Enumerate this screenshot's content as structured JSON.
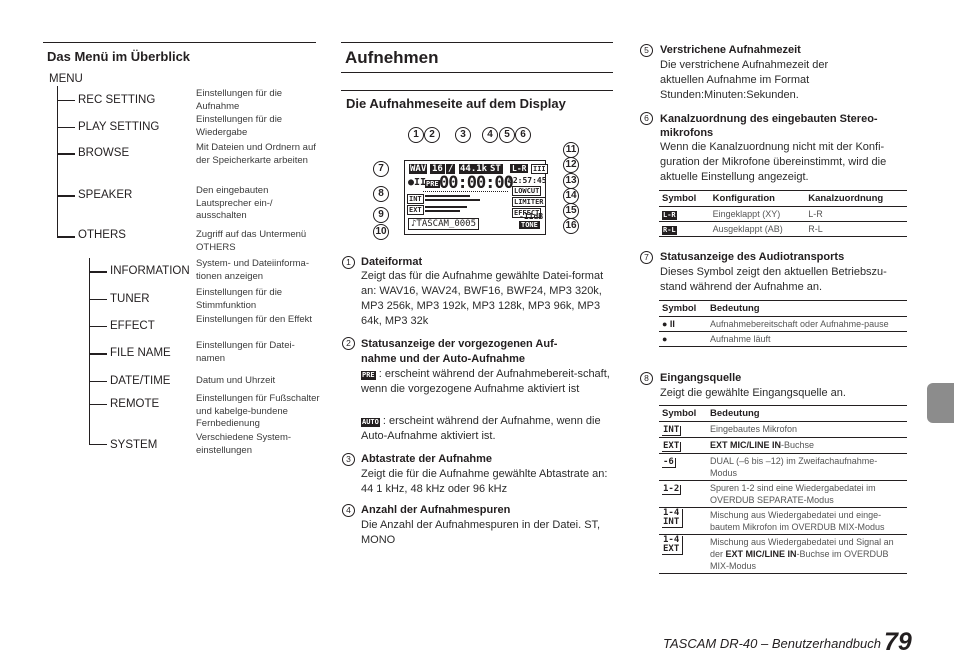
{
  "menu_section": {
    "heading": "Das Menü im Überblick",
    "root": "MENU",
    "items": [
      {
        "label": "REC SETTING",
        "desc": "Einstellungen für die Aufnahme"
      },
      {
        "label": "PLAY SETTING",
        "desc": "Einstellungen für die Wiedergabe"
      },
      {
        "label": "BROWSE",
        "desc": "Mit Dateien und Ordnern auf der Speicherkarte arbeiten"
      },
      {
        "label": "SPEAKER",
        "desc": "Den eingebauten Lautsprecher ein-/ ausschalten"
      },
      {
        "label": "OTHERS",
        "desc": "Zugriff auf das Untermenü OTHERS"
      }
    ],
    "sub_items": [
      {
        "label": "INFORMATION",
        "desc": "System- und Dateiinforma-tionen anzeigen"
      },
      {
        "label": "TUNER",
        "desc": "Einstellungen für die Stimmfunktion"
      },
      {
        "label": "EFFECT",
        "desc": "Einstellungen für den Effekt"
      },
      {
        "label": "FILE NAME",
        "desc": "Einstellungen für Datei-namen"
      },
      {
        "label": "DATE/TIME",
        "desc": "Datum und Uhrzeit"
      },
      {
        "label": "REMOTE",
        "desc": "Einstellungen für Fußschalter und kabelge-bundene Fernbedienung"
      },
      {
        "label": "SYSTEM",
        "desc": "Verschiedene System-einstellungen"
      }
    ]
  },
  "record_section": {
    "title": "Aufnehmen",
    "subtitle": "Die Aufnahmeseite auf dem Display",
    "display": {
      "format": "WAV",
      "bits": "16",
      "slash": "/",
      "rate": "44.1k",
      "channels": "ST",
      "mic": "L-R",
      "battery": "III",
      "transport": "●II",
      "pre": "PRE",
      "elapsed": "00:00:00",
      "remaining": "02:57:45",
      "lowcut": "LOWCUT",
      "limiter": "LIMITER",
      "effect": "EFFECT",
      "level": "-11dB",
      "tone": "TONE",
      "int": "INT",
      "ext": "EXT",
      "filename": "♪TASCAM_0005",
      "callouts": [
        "1",
        "2",
        "3",
        "4",
        "5",
        "6",
        "7",
        "8",
        "9",
        "10",
        "11",
        "12",
        "13",
        "14",
        "15",
        "16"
      ]
    },
    "items": [
      {
        "num": "1",
        "title": "Dateiformat",
        "body": "Zeigt das für die Aufnahme gewählte Datei-format an: WAV16, WAV24, BWF16, BWF24, MP3 320k, MP3 256k, MP3 192k, MP3 128k, MP3 96k, MP3 64k, MP3 32k"
      },
      {
        "num": "2",
        "title": "Statusanzeige der vorgezogenen Auf-nahme und der Auto-Aufnahme",
        "pre_symbol": "PRE",
        "pre_text": " : erscheint während der Aufnahmebereit-schaft, wenn die vorgezogene Aufnahme aktiviert ist",
        "auto_symbol": "AUTO",
        "auto_text": " : erscheint während der Aufnahme, wenn die Auto-Aufnahme aktiviert ist."
      },
      {
        "num": "3",
        "title": "Abtastrate der Aufnahme",
        "body": "Zeigt die für die Aufnahme gewählte Abtastrate an: 44 1 kHz, 48 kHz oder 96 kHz"
      },
      {
        "num": "4",
        "title": "Anzahl der Aufnahmespuren",
        "body": "Die Anzahl der Aufnahmespuren in der Datei. ST, MONO"
      }
    ]
  },
  "right_column": {
    "items": [
      {
        "num": "5",
        "title": "Verstrichene Aufnahmezeit",
        "body": "Die verstrichene Aufnahmezeit der aktuellen Aufnahme im Format Stunden:Minuten:Sekunden."
      },
      {
        "num": "6",
        "title": "Kanalzuordnung des eingebauten Stereo-mikrofons",
        "body": "Wenn die Kanalzuordnung nicht mit der Konfi-guration der Mikrofone übereinstimmt, wird die aktuelle Einstellung angezeigt."
      },
      {
        "num": "7",
        "title": "Statusanzeige des Audiotransports",
        "body": "Dieses Symbol zeigt den aktuellen Betriebszu-stand während der Aufnahme an."
      },
      {
        "num": "8",
        "title": "Eingangsquelle",
        "body": "Zeigt die gewählte Eingangsquelle an."
      }
    ],
    "table_mic": {
      "headers": [
        "Symbol",
        "Konfiguration",
        "Kanalzuordnung"
      ],
      "rows": [
        {
          "symbol": "L-R",
          "config": "Eingeklappt (XY)",
          "mapping": "L-R"
        },
        {
          "symbol": "R-L",
          "config": "Ausgeklappt (AB)",
          "mapping": "R-L"
        }
      ]
    },
    "table_transport": {
      "headers": [
        "Symbol",
        "Bedeutung"
      ],
      "rows": [
        {
          "symbol": "● II",
          "meaning": "Aufnahmebereitschaft oder Aufnahme-pause"
        },
        {
          "symbol": "●",
          "meaning": "Aufnahme läuft"
        }
      ]
    },
    "table_input": {
      "headers": [
        "Symbol",
        "Bedeutung"
      ],
      "rows": [
        {
          "symbol": "INT",
          "meaning": "Eingebautes Mikrofon"
        },
        {
          "symbol": "EXT",
          "meaning_bold": "EXT MIC/LINE IN",
          "meaning": "-Buchse"
        },
        {
          "symbol": "-6",
          "meaning": "DUAL (–6 bis –12) im Zweifachaufnahme-Modus"
        },
        {
          "symbol": "1-2",
          "meaning": "Spuren 1-2 sind eine Wiedergabedatei im OVERDUB SEPARATE-Modus"
        },
        {
          "symbol": "1-4 INT",
          "meaning": "Mischung aus Wiedergabedatei und einge-bautem Mikrofon im OVERDUB MIX-Modus"
        },
        {
          "symbol": "1-4 EXT",
          "meaning_pre": "Mischung aus Wiedergabedatei und Signal an der ",
          "meaning_bold": "EXT MIC/LINE IN",
          "meaning": "-Buchse im OVERDUB MIX-Modus"
        }
      ]
    }
  },
  "footer": {
    "text": "TASCAM DR-40 – Benutzerhandbuch",
    "page": "79"
  },
  "colors": {
    "text": "#231f20",
    "tab": "#8c8c8c"
  }
}
